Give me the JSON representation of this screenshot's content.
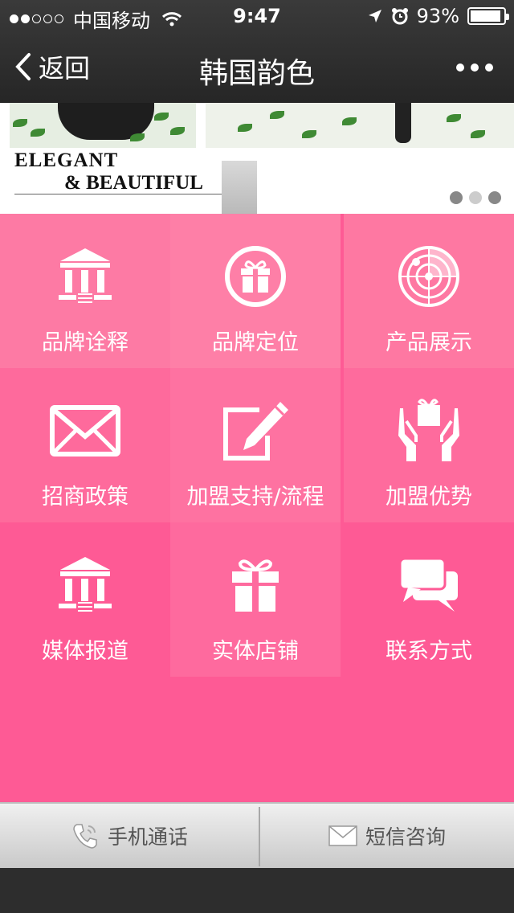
{
  "status_bar": {
    "carrier": "中国移动",
    "time": "9:47",
    "battery": "93%",
    "battery_level": 0.93
  },
  "nav": {
    "back_label": "返回",
    "title": "韩国韵色"
  },
  "banner": {
    "line1": "ELEGANT",
    "line2": "& BEAUTIFUL",
    "page_count": 3
  },
  "grid": {
    "items": [
      {
        "label": "品牌诠释",
        "icon": "building-icon"
      },
      {
        "label": "品牌定位",
        "icon": "gift-circle-icon"
      },
      {
        "label": "产品展示",
        "icon": "radar-icon"
      },
      {
        "label": "招商政策",
        "icon": "envelope-icon"
      },
      {
        "label": "加盟支持/流程",
        "icon": "edit-icon"
      },
      {
        "label": "加盟优势",
        "icon": "hands-gift-icon"
      },
      {
        "label": "媒体报道",
        "icon": "building-icon"
      },
      {
        "label": "实体店铺",
        "icon": "gift-icon"
      },
      {
        "label": "联系方式",
        "icon": "chat-icon"
      }
    ],
    "tile_colors": [
      "#fd7aa4",
      "#fe7fa7",
      "#fe78a2",
      "#fe6a9c",
      "#fe72a1",
      "#fe6b9d",
      "#fe5a95",
      "#fe6a9e",
      "#fe5a95"
    ],
    "background_color": "#fe5a95"
  },
  "bottom_bar": {
    "call_label": "手机通话",
    "sms_label": "短信咨询"
  }
}
